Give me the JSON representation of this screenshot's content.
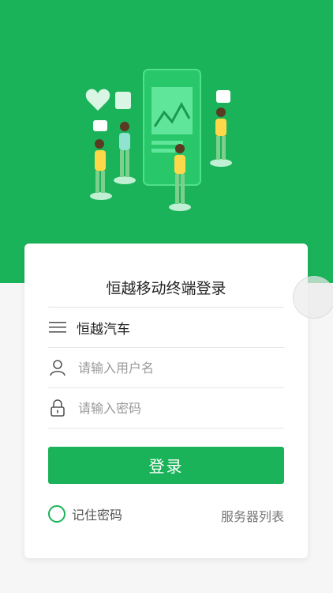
{
  "hero": {
    "background": "#1bb35a",
    "illustration": "social-media-people-illustration"
  },
  "login": {
    "title": "恒越移动终端登录",
    "company": "恒越汽车",
    "username_placeholder": "请输入用户名",
    "password_placeholder": "请输入密码",
    "login_button": "登录",
    "remember_label": "记住密码",
    "server_list_label": "服务器列表"
  },
  "icons": {
    "company": "menu-icon",
    "username": "user-icon",
    "password": "lock-icon",
    "remember": "radio-unchecked-icon"
  },
  "colors": {
    "accent": "#1bb35a",
    "text": "#222222",
    "placeholder": "#9a9a9a"
  }
}
